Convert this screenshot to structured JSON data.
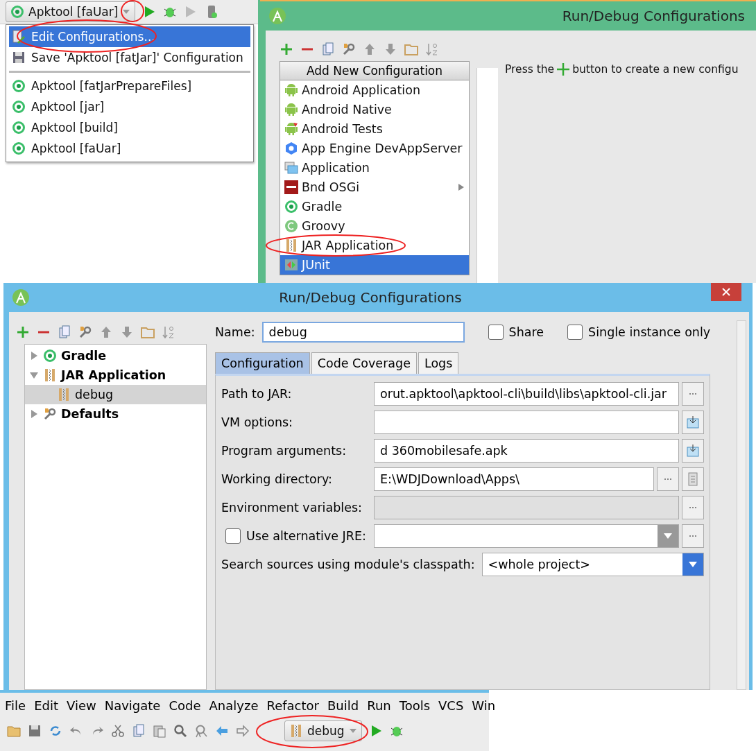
{
  "dropdown_screen": {
    "run_config": {
      "label": "Apktool [faUar]"
    },
    "menu": [
      {
        "kind": "edit",
        "label": "Edit Configurations...",
        "selected": true
      },
      {
        "kind": "save",
        "label": "Save 'Apktool [fatJar]' Configuration",
        "selected": false
      },
      {
        "kind": "separator"
      },
      {
        "kind": "gradle",
        "label": "Apktool [fatJarPrepareFiles]",
        "selected": false
      },
      {
        "kind": "gradle",
        "label": "Apktool [jar]",
        "selected": false
      },
      {
        "kind": "gradle",
        "label": "Apktool [build]",
        "selected": false
      },
      {
        "kind": "gradle",
        "label": "Apktool [faUar]",
        "selected": false
      }
    ]
  },
  "add_dialog": {
    "title": "Run/Debug Configurations",
    "popup_title": "Add New Configuration",
    "items": [
      {
        "kind": "android",
        "label": "Android Application",
        "selected": false,
        "has_submenu": false
      },
      {
        "kind": "android",
        "label": "Android Native",
        "selected": false,
        "has_submenu": false
      },
      {
        "kind": "android-tests",
        "label": "Android Tests",
        "selected": false,
        "has_submenu": false
      },
      {
        "kind": "appengine",
        "label": "App Engine DevAppServer",
        "selected": false,
        "has_submenu": false
      },
      {
        "kind": "application",
        "label": "Application",
        "selected": false,
        "has_submenu": false
      },
      {
        "kind": "bnd",
        "label": "Bnd OSGi",
        "selected": false,
        "has_submenu": true
      },
      {
        "kind": "gradle",
        "label": "Gradle",
        "selected": false,
        "has_submenu": false
      },
      {
        "kind": "groovy",
        "label": "Groovy",
        "selected": false,
        "has_submenu": false
      },
      {
        "kind": "jar",
        "label": "JAR Application",
        "selected": false,
        "has_submenu": false
      },
      {
        "kind": "junit",
        "label": "JUnit",
        "selected": true,
        "has_submenu": false
      }
    ],
    "hint_before": "Press the",
    "hint_after": "button to create a new configu"
  },
  "config_dialog": {
    "title": "Run/Debug Configurations",
    "tree": [
      {
        "kind": "gradle",
        "label": "Gradle",
        "expanded": false,
        "selected": false
      },
      {
        "kind": "jar",
        "label": "JAR Application",
        "expanded": true,
        "selected": false,
        "children": [
          {
            "kind": "jar",
            "label": "debug",
            "selected": true
          }
        ]
      },
      {
        "kind": "defaults",
        "label": "Defaults",
        "expanded": false,
        "selected": false
      }
    ],
    "name_label": "Name:",
    "name_value": "debug",
    "options": [
      {
        "label": "Share",
        "checked": false
      },
      {
        "label": "Single instance only",
        "checked": false
      }
    ],
    "tabs": [
      {
        "label": "Configuration",
        "selected": true
      },
      {
        "label": "Code Coverage",
        "selected": false
      },
      {
        "label": "Logs",
        "selected": false
      }
    ],
    "fields": [
      {
        "kind": "browse",
        "label": "Path to JAR:",
        "value": "orut.apktool\\apktool-cli\\build\\libs\\apktool-cli.jar",
        "disabled": false
      },
      {
        "kind": "expand",
        "label": "VM options:",
        "disabled": false
      },
      {
        "kind": "expand",
        "label": "Program arguments:",
        "value": "d 360mobilesafe.apk",
        "disabled": false
      },
      {
        "kind": "browse-macro",
        "label": "Working directory:",
        "value": "E:\\WDJDownload\\Apps\\",
        "disabled": false
      },
      {
        "kind": "browse",
        "label": "Environment variables:",
        "disabled": true
      }
    ],
    "alt_jre": {
      "label": "Use alternative JRE:",
      "checked": false
    },
    "classpath": {
      "label": "Search sources using module's classpath:",
      "value": "<whole project>"
    }
  },
  "ide": {
    "menu": [
      "File",
      "Edit",
      "View",
      "Navigate",
      "Code",
      "Analyze",
      "Refactor",
      "Build",
      "Run",
      "Tools",
      "VCS",
      "Win"
    ],
    "run_config": {
      "label": "debug"
    }
  }
}
